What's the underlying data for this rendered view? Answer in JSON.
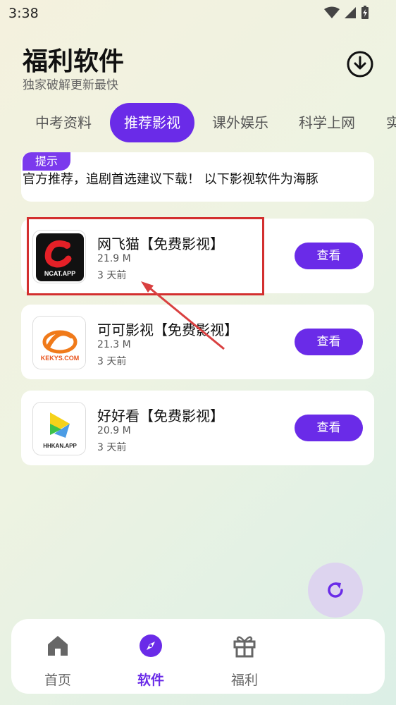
{
  "status_bar": {
    "time": "3:38"
  },
  "header": {
    "title": "福利软件",
    "subtitle": "独家破解更新最快"
  },
  "tabs": [
    {
      "label": "中考资料"
    },
    {
      "label": "推荐影视"
    },
    {
      "label": "课外娱乐"
    },
    {
      "label": "科学上网"
    },
    {
      "label": "实"
    }
  ],
  "notice": {
    "badge": "提示",
    "text": "官方推荐，追剧首选建议下载！   以下影视软件为海豚"
  },
  "apps": [
    {
      "name": "网飞猫【免费影视】",
      "size": "21.9 M",
      "time": "3 天前",
      "button": "查看",
      "icon_text": "NCAT.APP"
    },
    {
      "name": "可可影视【免费影视】",
      "size": "21.3 M",
      "time": "3 天前",
      "button": "查看",
      "icon_text": "KEKYS.COM"
    },
    {
      "name": "好好看【免费影视】",
      "size": "20.9 M",
      "time": "3 天前",
      "button": "查看",
      "icon_text": "HHKAN.APP"
    }
  ],
  "bottom_nav": [
    {
      "label": "首页",
      "icon": "home-icon"
    },
    {
      "label": "软件",
      "icon": "compass-icon"
    },
    {
      "label": "福利",
      "icon": "gift-icon"
    }
  ],
  "colors": {
    "accent": "#6a2be8",
    "highlight": "#d32f2f"
  }
}
